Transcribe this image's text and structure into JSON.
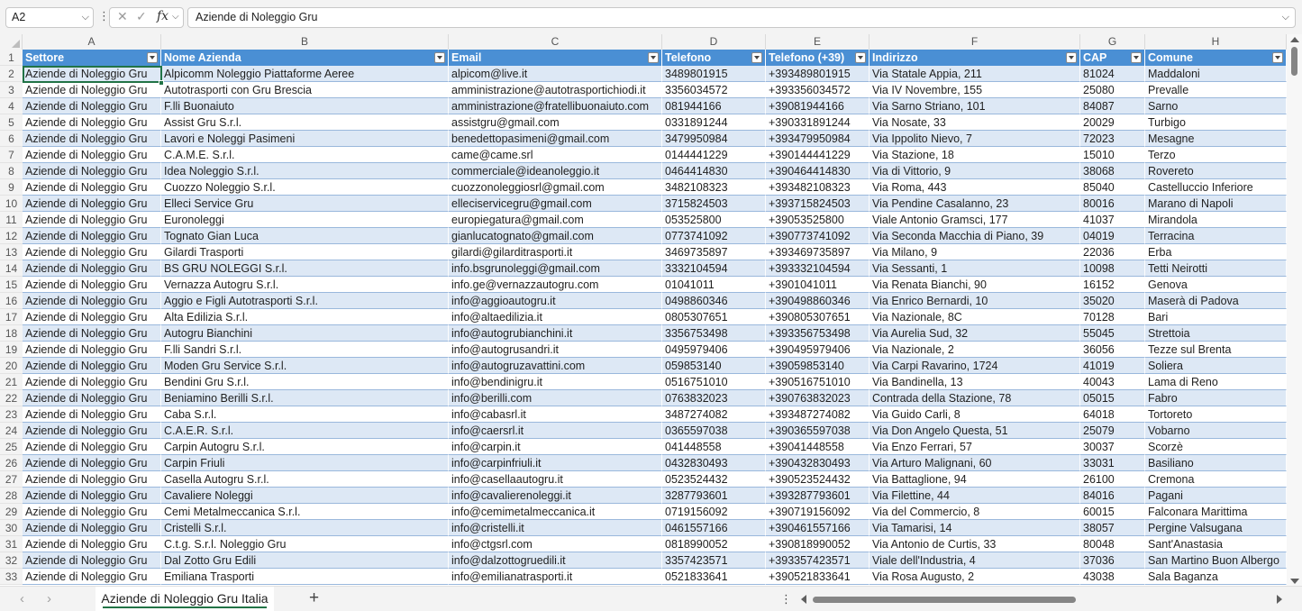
{
  "formula_bar": {
    "name_box": "A2",
    "fx": "fx",
    "content": "Aziende di Noleggio Gru"
  },
  "sheet": {
    "column_letters": [
      "A",
      "B",
      "C",
      "D",
      "E",
      "F",
      "G",
      "H"
    ],
    "headers": [
      "Settore",
      "Nome Azienda",
      "Email",
      "Telefono",
      "Telefono (+39)",
      "Indirizzo",
      "CAP",
      "Comune"
    ],
    "header_row_number": "1",
    "rows": [
      {
        "n": "2",
        "cells": [
          "Aziende di Noleggio Gru",
          "Alpicomm Noleggio Piattaforme Aeree",
          "alpicom@live.it",
          "3489801915",
          "+393489801915",
          "Via Statale Appia, 211",
          "81024",
          "Maddaloni"
        ]
      },
      {
        "n": "3",
        "cells": [
          "Aziende di Noleggio Gru",
          "Autotrasporti con Gru Brescia",
          "amministrazione@autotrasportichiodi.it",
          "3356034572",
          "+393356034572",
          "Via IV Novembre, 155",
          "25080",
          "Prevalle"
        ]
      },
      {
        "n": "4",
        "cells": [
          "Aziende di Noleggio Gru",
          "F.lli Buonaiuto",
          "amministrazione@fratellibuonaiuto.com",
          "081944166",
          "+39081944166",
          "Via Sarno Striano, 101",
          "84087",
          "Sarno"
        ]
      },
      {
        "n": "5",
        "cells": [
          "Aziende di Noleggio Gru",
          "Assist Gru S.r.l.",
          "assistgru@gmail.com",
          "0331891244",
          "+390331891244",
          "Via Nosate, 33",
          "20029",
          "Turbigo"
        ]
      },
      {
        "n": "6",
        "cells": [
          "Aziende di Noleggio Gru",
          "Lavori e Noleggi Pasimeni",
          "benedettopasimeni@gmail.com",
          "3479950984",
          "+393479950984",
          "Via Ippolito Nievo, 7",
          "72023",
          "Mesagne"
        ]
      },
      {
        "n": "7",
        "cells": [
          "Aziende di Noleggio Gru",
          "C.A.M.E. S.r.l.",
          "came@came.srl",
          "0144441229",
          "+390144441229",
          "Via Stazione, 18",
          "15010",
          "Terzo"
        ]
      },
      {
        "n": "8",
        "cells": [
          "Aziende di Noleggio Gru",
          "Idea Noleggio S.r.l.",
          "commerciale@ideanoleggio.it",
          "0464414830",
          "+390464414830",
          "Via di Vittorio, 9",
          "38068",
          "Rovereto"
        ]
      },
      {
        "n": "9",
        "cells": [
          "Aziende di Noleggio Gru",
          "Cuozzo Noleggio S.r.l.",
          "cuozzonoleggiosrl@gmail.com",
          "3482108323",
          "+393482108323",
          "Via Roma, 443",
          "85040",
          "Castelluccio Inferiore"
        ]
      },
      {
        "n": "10",
        "cells": [
          "Aziende di Noleggio Gru",
          "Elleci Service Gru",
          "elleciservicegru@gmail.com",
          "3715824503",
          "+393715824503",
          "Via Pendine Casalanno, 23",
          "80016",
          "Marano di Napoli"
        ]
      },
      {
        "n": "11",
        "cells": [
          "Aziende di Noleggio Gru",
          "Euronoleggi",
          "europiegatura@gmail.com",
          "053525800",
          "+39053525800",
          "Viale Antonio Gramsci, 177",
          "41037",
          "Mirandola"
        ]
      },
      {
        "n": "12",
        "cells": [
          "Aziende di Noleggio Gru",
          "Tognato Gian Luca",
          "gianlucatognato@gmail.com",
          "0773741092",
          "+390773741092",
          "Via Seconda Macchia di Piano, 39",
          "04019",
          "Terracina"
        ]
      },
      {
        "n": "13",
        "cells": [
          "Aziende di Noleggio Gru",
          "Gilardi Trasporti",
          "gilardi@gilarditrasporti.it",
          "3469735897",
          "+393469735897",
          "Via Milano, 9",
          "22036",
          "Erba"
        ]
      },
      {
        "n": "14",
        "cells": [
          "Aziende di Noleggio Gru",
          "BS GRU NOLEGGI S.r.l.",
          "info.bsgrunoleggi@gmail.com",
          "3332104594",
          "+393332104594",
          "Via Sessanti, 1",
          "10098",
          "Tetti Neirotti"
        ]
      },
      {
        "n": "15",
        "cells": [
          "Aziende di Noleggio Gru",
          "Vernazza Autogru S.r.l.",
          "info.ge@vernazzautogru.com",
          "01041011",
          "+3901041011",
          "Via Renata Bianchi, 90",
          "16152",
          "Genova"
        ]
      },
      {
        "n": "16",
        "cells": [
          "Aziende di Noleggio Gru",
          "Aggio e Figli Autotrasporti S.r.l.",
          "info@aggioautogru.it",
          "0498860346",
          "+390498860346",
          "Via Enrico Bernardi, 10",
          "35020",
          "Maserà di Padova"
        ]
      },
      {
        "n": "17",
        "cells": [
          "Aziende di Noleggio Gru",
          "Alta Edilizia S.r.l.",
          "info@altaedilizia.it",
          "0805307651",
          "+390805307651",
          "Via Nazionale, 8C",
          "70128",
          "Bari"
        ]
      },
      {
        "n": "18",
        "cells": [
          "Aziende di Noleggio Gru",
          "Autogru Bianchini",
          "info@autogrubianchini.it",
          "3356753498",
          "+393356753498",
          "Via Aurelia Sud, 32",
          "55045",
          "Strettoia"
        ]
      },
      {
        "n": "19",
        "cells": [
          "Aziende di Noleggio Gru",
          "F.lli Sandri S.r.l.",
          "info@autogrusandri.it",
          "0495979406",
          "+390495979406",
          "Via Nazionale, 2",
          "36056",
          "Tezze sul Brenta"
        ]
      },
      {
        "n": "20",
        "cells": [
          "Aziende di Noleggio Gru",
          "Moden Gru Service S.r.l.",
          "info@autogruzavattini.com",
          "059853140",
          "+39059853140",
          "Via Carpi Ravarino, 1724",
          "41019",
          "Soliera"
        ]
      },
      {
        "n": "21",
        "cells": [
          "Aziende di Noleggio Gru",
          "Bendini Gru S.r.l.",
          "info@bendinigru.it",
          "0516751010",
          "+390516751010",
          "Via Bandinella, 13",
          "40043",
          "Lama di Reno"
        ]
      },
      {
        "n": "22",
        "cells": [
          "Aziende di Noleggio Gru",
          "Beniamino Berilli S.r.l.",
          "info@berilli.com",
          "0763832023",
          "+390763832023",
          "Contrada della Stazione, 78",
          "05015",
          "Fabro"
        ]
      },
      {
        "n": "23",
        "cells": [
          "Aziende di Noleggio Gru",
          "Caba S.r.l.",
          "info@cabasrl.it",
          "3487274082",
          "+393487274082",
          "Via Guido Carli, 8",
          "64018",
          "Tortoreto"
        ]
      },
      {
        "n": "24",
        "cells": [
          "Aziende di Noleggio Gru",
          "C.A.E.R. S.r.l.",
          "info@caersrl.it",
          "0365597038",
          "+390365597038",
          "Via Don Angelo Questa, 51",
          "25079",
          "Vobarno"
        ]
      },
      {
        "n": "25",
        "cells": [
          "Aziende di Noleggio Gru",
          "Carpin Autogru S.r.l.",
          "info@carpin.it",
          "041448558",
          "+39041448558",
          "Via Enzo Ferrari, 57",
          "30037",
          "Scorzè"
        ]
      },
      {
        "n": "26",
        "cells": [
          "Aziende di Noleggio Gru",
          "Carpin Friuli",
          "info@carpinfriuli.it",
          "0432830493",
          "+390432830493",
          "Via Arturo Malignani, 60",
          "33031",
          "Basiliano"
        ]
      },
      {
        "n": "27",
        "cells": [
          "Aziende di Noleggio Gru",
          "Casella Autogru S.r.l.",
          "info@casellaautogru.it",
          "0523524432",
          "+390523524432",
          "Via Battaglione, 94",
          "26100",
          "Cremona"
        ]
      },
      {
        "n": "28",
        "cells": [
          "Aziende di Noleggio Gru",
          "Cavaliere Noleggi",
          "info@cavalierenoleggi.it",
          "3287793601",
          "+393287793601",
          "Via Filettine, 44",
          "84016",
          "Pagani"
        ]
      },
      {
        "n": "29",
        "cells": [
          "Aziende di Noleggio Gru",
          "Cemi Metalmeccanica S.r.l.",
          "info@cemimetalmeccanica.it",
          "0719156092",
          "+390719156092",
          "Via del Commercio, 8",
          "60015",
          "Falconara Marittima"
        ]
      },
      {
        "n": "30",
        "cells": [
          "Aziende di Noleggio Gru",
          "Cristelli S.r.l.",
          "info@cristelli.it",
          "0461557166",
          "+390461557166",
          "Via Tamarisi, 14",
          "38057",
          "Pergine Valsugana"
        ]
      },
      {
        "n": "31",
        "cells": [
          "Aziende di Noleggio Gru",
          "C.t.g. S.r.l. Noleggio Gru",
          "info@ctgsrl.com",
          "0818990052",
          "+390818990052",
          "Via Antonio de Curtis, 33",
          "80048",
          "Sant'Anastasia"
        ]
      },
      {
        "n": "32",
        "cells": [
          "Aziende di Noleggio Gru",
          "Dal Zotto Gru Edili",
          "info@dalzottogruedili.it",
          "3357423571",
          "+393357423571",
          "Viale dell'Industria, 4",
          "37036",
          "San Martino Buon Albergo"
        ]
      },
      {
        "n": "33",
        "cells": [
          "Aziende di Noleggio Gru",
          "Emiliana Trasporti",
          "info@emilianatrasporti.it",
          "0521833641",
          "+390521833641",
          "Via Rosa Augusto, 2",
          "43038",
          "Sala Baganza"
        ]
      }
    ]
  },
  "bottom_bar": {
    "sheet_tab": "Aziende di Noleggio Gru Italia",
    "add_sheet": "+",
    "prev": "‹",
    "next": "›"
  },
  "colors": {
    "header_fill": "#4a8fd4",
    "band_fill": "#dde8f5",
    "accent": "#217346"
  }
}
